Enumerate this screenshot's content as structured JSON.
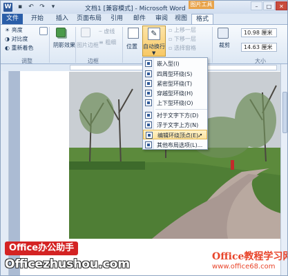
{
  "titlebar": {
    "app_letter": "W",
    "title": "文档1 [兼容模式] - Microsoft Word",
    "context_tab": "图片工具",
    "qat": [
      "save",
      "undo",
      "redo",
      "customize"
    ]
  },
  "tabs": [
    {
      "label": "文件"
    },
    {
      "label": "开始"
    },
    {
      "label": "插入"
    },
    {
      "label": "页面布局"
    },
    {
      "label": "引用"
    },
    {
      "label": "邮件"
    },
    {
      "label": "审阅"
    },
    {
      "label": "视图"
    },
    {
      "label": "格式"
    }
  ],
  "ribbon": {
    "adjust": {
      "brightness": "亮度",
      "contrast": "对比度",
      "recolor": "重新着色",
      "group_label": "调整"
    },
    "shadow": {
      "label": "阴影效果"
    },
    "border": {
      "picture_border": "图片边框",
      "dashes": "虚线",
      "weight": "粗细",
      "group_label": "边框"
    },
    "arrange": {
      "position": "位置",
      "wrap_text": "自动换行",
      "bring_forward": "上移一层",
      "send_backward": "下移一层",
      "selection_pane": "选择窗格"
    },
    "size": {
      "crop": "裁剪",
      "height": "10.98 厘米",
      "width": "14.63 厘米",
      "group_label": "大小"
    }
  },
  "wrap_menu": {
    "items": [
      {
        "label": "嵌入型(I)"
      },
      {
        "label": "四周型环绕(S)"
      },
      {
        "label": "紧密型环绕(T)"
      },
      {
        "label": "穿越型环绕(H)"
      },
      {
        "label": "上下型环绕(O)"
      },
      {
        "label": "衬于文字下方(D)"
      },
      {
        "label": "浮于文字上方(N)"
      },
      {
        "label": "编辑环绕顶点(E)"
      },
      {
        "label": "其他布局选项(L)..."
      }
    ],
    "highlighted": "编辑环绕顶点(E)"
  },
  "watermarks": {
    "left_top": "Office办公助手",
    "left_bottom": "Officezhushou.com",
    "right_top": "Office教程学习网",
    "right_bottom": "www.office68.com"
  },
  "colors": {
    "file_tab": "#2a5ea8",
    "context_tab": "#e8a34a",
    "highlight": "#fde3a0"
  }
}
